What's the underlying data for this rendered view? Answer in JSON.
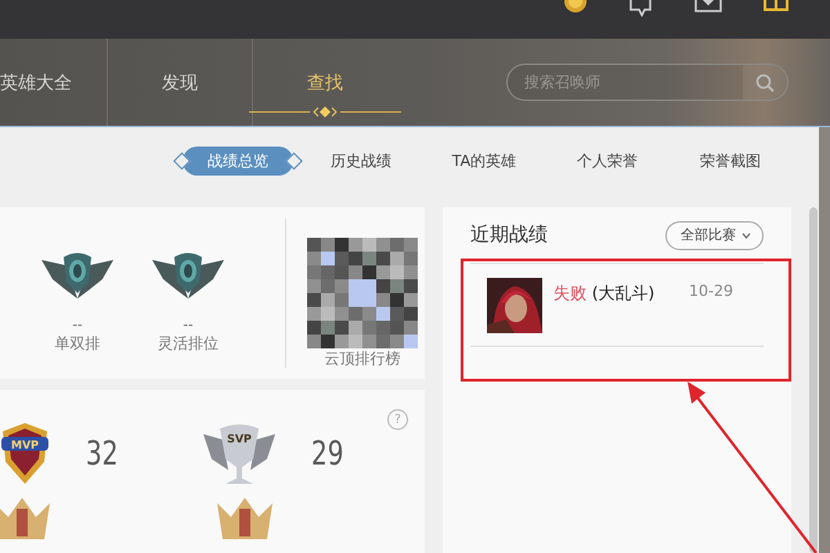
{
  "nav": {
    "items": [
      {
        "label": "英雄大全",
        "selected": false
      },
      {
        "label": "发现",
        "selected": false
      },
      {
        "label": "查找",
        "selected": true
      }
    ],
    "search": {
      "placeholder": "搜索召唤师"
    }
  },
  "tabs": [
    {
      "label": "战绩总览",
      "selected": true
    },
    {
      "label": "历史战绩",
      "selected": false
    },
    {
      "label": "TA的英雄",
      "selected": false
    },
    {
      "label": "个人荣誉",
      "selected": false
    },
    {
      "label": "荣誉截图",
      "selected": false
    }
  ],
  "rank_card": {
    "queues": [
      {
        "rank": "--",
        "label": "单双排"
      },
      {
        "rank": "--",
        "label": "灵活排位"
      }
    ],
    "tft": {
      "kind": "picture",
      "label": "云顶排行榜"
    }
  },
  "honors_help": "?",
  "honors": [
    {
      "kind": "mvp",
      "badge": "MVP",
      "count": "32"
    },
    {
      "kind": "svp",
      "badge": "SVP",
      "count": "29"
    },
    {
      "kind": "crest"
    },
    {
      "kind": "crest"
    }
  ],
  "recent": {
    "title": "近期战绩",
    "filter": "全部比赛",
    "matches": [
      {
        "result": "失败",
        "win": false,
        "mode": "(大乱斗)",
        "date": "10-29"
      }
    ]
  }
}
